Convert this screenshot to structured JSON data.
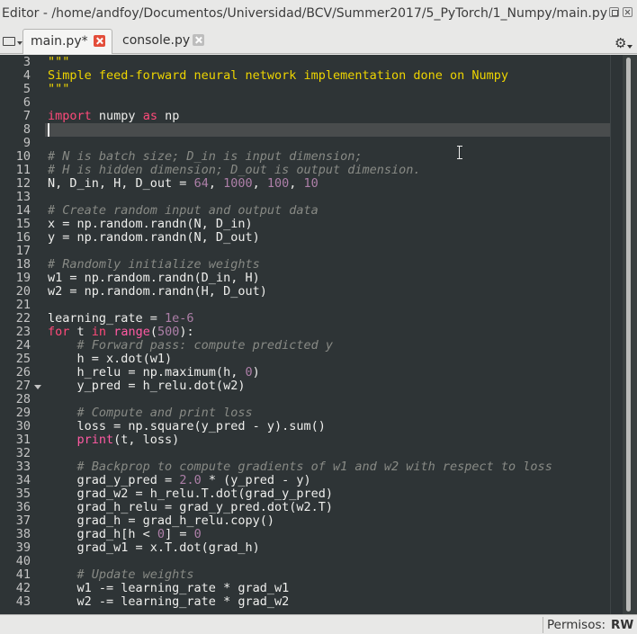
{
  "window": {
    "title": "Editor - /home/andfoy/Documentos/Universidad/BCV/Summer2017/5_PyTorch/1_Numpy/main.py"
  },
  "tabs": [
    {
      "label": "main.py*",
      "active": true
    },
    {
      "label": "console.py",
      "active": false
    }
  ],
  "icons": {
    "files": "folder-icon",
    "gear": "gear-icon",
    "close": "close-icon"
  },
  "colors": {
    "editor_bg": "#2e3436",
    "keyword": "#ff4a7a",
    "comment": "#888a85",
    "string": "#edd400",
    "number": "#ad7fa8"
  },
  "editor": {
    "current_line": 8,
    "lines": [
      {
        "n": "3",
        "segs": [
          {
            "t": "\"\"\"",
            "c": "s"
          }
        ]
      },
      {
        "n": "4",
        "segs": [
          {
            "t": "Simple feed-forward neural network implementation done on Numpy",
            "c": "s"
          }
        ]
      },
      {
        "n": "5",
        "segs": [
          {
            "t": "\"\"\"",
            "c": "s"
          }
        ]
      },
      {
        "n": "6",
        "segs": []
      },
      {
        "n": "7",
        "segs": [
          {
            "t": "import",
            "c": "k"
          },
          {
            "t": " numpy "
          },
          {
            "t": "as",
            "c": "k"
          },
          {
            "t": " np"
          }
        ]
      },
      {
        "n": "8",
        "segs": []
      },
      {
        "n": "9",
        "segs": []
      },
      {
        "n": "10",
        "segs": [
          {
            "t": "# N is batch size; D_in is input dimension;",
            "c": "c"
          }
        ]
      },
      {
        "n": "11",
        "segs": [
          {
            "t": "# H is hidden dimension; D_out is output dimension.",
            "c": "c"
          }
        ]
      },
      {
        "n": "12",
        "segs": [
          {
            "t": "N, D_in, H, D_out = "
          },
          {
            "t": "64",
            "c": "n"
          },
          {
            "t": ", "
          },
          {
            "t": "1000",
            "c": "n"
          },
          {
            "t": ", "
          },
          {
            "t": "100",
            "c": "n"
          },
          {
            "t": ", "
          },
          {
            "t": "10",
            "c": "n"
          }
        ]
      },
      {
        "n": "13",
        "segs": []
      },
      {
        "n": "14",
        "segs": [
          {
            "t": "# Create random input and output data",
            "c": "c"
          }
        ]
      },
      {
        "n": "15",
        "segs": [
          {
            "t": "x = np.random.randn(N, D_in)"
          }
        ]
      },
      {
        "n": "16",
        "segs": [
          {
            "t": "y = np.random.randn(N, D_out)"
          }
        ]
      },
      {
        "n": "17",
        "segs": []
      },
      {
        "n": "18",
        "segs": [
          {
            "t": "# Randomly initialize weights",
            "c": "c"
          }
        ]
      },
      {
        "n": "19",
        "segs": [
          {
            "t": "w1 = np.random.randn(D_in, H)"
          }
        ]
      },
      {
        "n": "20",
        "segs": [
          {
            "t": "w2 = np.random.randn(H, D_out)"
          }
        ]
      },
      {
        "n": "21",
        "segs": []
      },
      {
        "n": "22",
        "segs": [
          {
            "t": "learning_rate = "
          },
          {
            "t": "1e-6",
            "c": "n"
          }
        ]
      },
      {
        "n": "23",
        "segs": [
          {
            "t": "for",
            "c": "k"
          },
          {
            "t": " t "
          },
          {
            "t": "in",
            "c": "k"
          },
          {
            "t": " "
          },
          {
            "t": "range",
            "c": "b"
          },
          {
            "t": "("
          },
          {
            "t": "500",
            "c": "n"
          },
          {
            "t": "):"
          }
        ]
      },
      {
        "n": "24",
        "segs": [
          {
            "t": "    "
          },
          {
            "t": "# Forward pass: compute predicted y",
            "c": "c"
          }
        ]
      },
      {
        "n": "25",
        "segs": [
          {
            "t": "    h = x.dot(w1)"
          }
        ]
      },
      {
        "n": "26",
        "segs": [
          {
            "t": "    h_relu = np.maximum(h, "
          },
          {
            "t": "0",
            "c": "n"
          },
          {
            "t": ")"
          }
        ]
      },
      {
        "n": "27",
        "segs": [
          {
            "t": "    y_pred = h_relu.dot(w2)"
          }
        ]
      },
      {
        "n": "28",
        "segs": []
      },
      {
        "n": "29",
        "segs": [
          {
            "t": "    "
          },
          {
            "t": "# Compute and print loss",
            "c": "c"
          }
        ]
      },
      {
        "n": "30",
        "segs": [
          {
            "t": "    loss = np.square(y_pred - y).sum()"
          }
        ]
      },
      {
        "n": "31",
        "segs": [
          {
            "t": "    "
          },
          {
            "t": "print",
            "c": "b"
          },
          {
            "t": "(t, loss)"
          }
        ]
      },
      {
        "n": "32",
        "segs": []
      },
      {
        "n": "33",
        "segs": [
          {
            "t": "    "
          },
          {
            "t": "# Backprop to compute gradients of w1 and w2 with respect to loss",
            "c": "c"
          }
        ]
      },
      {
        "n": "34",
        "segs": [
          {
            "t": "    grad_y_pred = "
          },
          {
            "t": "2.0",
            "c": "n"
          },
          {
            "t": " * (y_pred - y)"
          }
        ]
      },
      {
        "n": "35",
        "segs": [
          {
            "t": "    grad_w2 = h_relu.T.dot(grad_y_pred)"
          }
        ]
      },
      {
        "n": "36",
        "segs": [
          {
            "t": "    grad_h_relu = grad_y_pred.dot(w2.T)"
          }
        ]
      },
      {
        "n": "37",
        "segs": [
          {
            "t": "    grad_h = grad_h_relu.copy()"
          }
        ]
      },
      {
        "n": "38",
        "segs": [
          {
            "t": "    grad_h[h < "
          },
          {
            "t": "0",
            "c": "n"
          },
          {
            "t": "] = "
          },
          {
            "t": "0",
            "c": "n"
          }
        ]
      },
      {
        "n": "39",
        "segs": [
          {
            "t": "    grad_w1 = x.T.dot(grad_h)"
          }
        ]
      },
      {
        "n": "40",
        "segs": []
      },
      {
        "n": "41",
        "segs": [
          {
            "t": "    "
          },
          {
            "t": "# Update weights",
            "c": "c"
          }
        ]
      },
      {
        "n": "42",
        "segs": [
          {
            "t": "    w1 -= learning_rate * grad_w1"
          }
        ]
      },
      {
        "n": "43",
        "segs": [
          {
            "t": "    w2 -= learning_rate * grad_w2"
          }
        ]
      }
    ]
  },
  "status": {
    "permissions_label": "Permisos:",
    "permissions_value": "RW"
  }
}
